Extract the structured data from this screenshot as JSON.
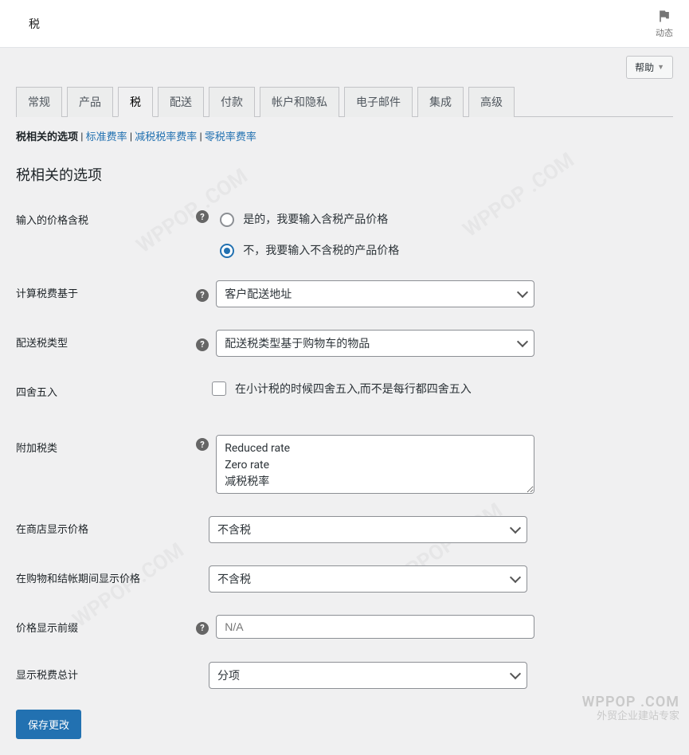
{
  "topbar": {
    "title": "税",
    "activity_label": "动态"
  },
  "help_button": "帮助",
  "tabs": [
    {
      "label": "常规",
      "active": false
    },
    {
      "label": "产品",
      "active": false
    },
    {
      "label": "税",
      "active": true
    },
    {
      "label": "配送",
      "active": false
    },
    {
      "label": "付款",
      "active": false
    },
    {
      "label": "帐户和隐私",
      "active": false
    },
    {
      "label": "电子邮件",
      "active": false
    },
    {
      "label": "集成",
      "active": false
    },
    {
      "label": "高级",
      "active": false
    }
  ],
  "subsub": {
    "current": "税相关的选项",
    "links": [
      "标准费率",
      "减税税率费率",
      "零税率费率"
    ]
  },
  "heading": "税相关的选项",
  "fields": {
    "prices_include_tax": {
      "label": "输入的价格含税",
      "yes": "是的，我要输入含税产品价格",
      "no": "不，我要输入不含税的产品价格",
      "selected": "no"
    },
    "tax_based_on": {
      "label": "计算税费基于",
      "value": "客户配送地址"
    },
    "shipping_tax_class": {
      "label": "配送税类型",
      "value": "配送税类型基于购物车的物品"
    },
    "rounding": {
      "label": "四舍五入",
      "checkbox_label": "在小计税的时候四舍五入,而不是每行都四舍五入",
      "checked": false
    },
    "additional_tax_classes": {
      "label": "附加税类",
      "value": "Reduced rate\nZero rate\n减税税率"
    },
    "display_shop": {
      "label": "在商店显示价格",
      "value": "不含税"
    },
    "display_cart": {
      "label": "在购物和结帐期间显示价格",
      "value": "不含税"
    },
    "display_suffix": {
      "label": "价格显示前缀",
      "placeholder": "N/A",
      "value": ""
    },
    "display_totals": {
      "label": "显示税费总计",
      "value": "分项"
    }
  },
  "submit_label": "保存更改",
  "watermark": {
    "line1": "WPPOP .COM",
    "line2": "外贸企业建站专家"
  }
}
